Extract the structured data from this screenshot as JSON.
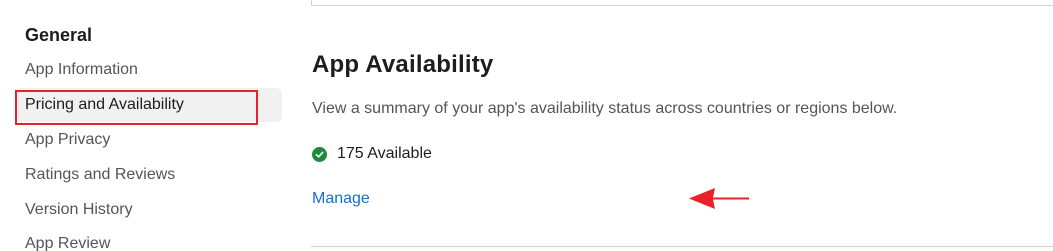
{
  "sidebar": {
    "heading": "General",
    "items": [
      {
        "label": "App Information"
      },
      {
        "label": "Pricing and Availability"
      },
      {
        "label": "App Privacy"
      },
      {
        "label": "Ratings and Reviews"
      },
      {
        "label": "Version History"
      },
      {
        "label": "App Review"
      }
    ],
    "active_item": "Pricing and Availability"
  },
  "main": {
    "title": "App Availability",
    "description": "View a summary of your app's availability status across countries or regions below.",
    "availability": {
      "status_icon": "check-circle-icon",
      "text": "175 Available"
    },
    "manage_link": "Manage"
  },
  "colors": {
    "highlight": "#e8212a",
    "link": "#1670c4",
    "status_green": "#1f8a3b",
    "active_bg": "#f1f1f2"
  }
}
